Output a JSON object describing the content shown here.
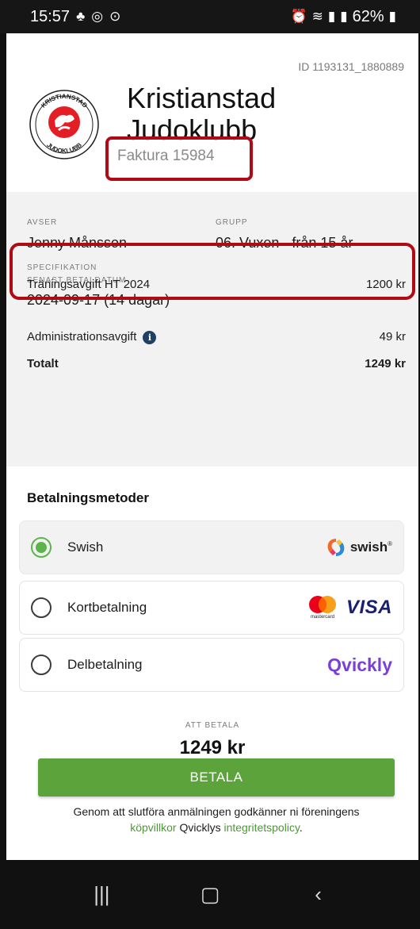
{
  "status_bar": {
    "time": "15:57",
    "battery": "62%",
    "left_icons": [
      "group-icon",
      "nfc-icon",
      "location-icon"
    ],
    "right_icons": [
      "alarm-icon",
      "wifi-icon",
      "signal-icon",
      "signal-icon",
      "battery-icon"
    ]
  },
  "invoice": {
    "id_text": "ID 1193131_1880889",
    "club_name": "Kristianstad Judoklubb",
    "invoice_number": "Faktura 15984",
    "logo": {
      "top_text": "KRISTIANSTAD",
      "bottom_text": "JUDOKLUBB"
    }
  },
  "details": {
    "avser_label": "AVSER",
    "avser_value": "Jenny Månsson",
    "grupp_label": "GRUPP",
    "grupp_value": "06. Vuxen - från 15 år",
    "due_label": "SENAST BETALDATUM",
    "due_value": "2024-09-17 (14 dagar)"
  },
  "specification": {
    "label": "SPECIFIKATION",
    "rows": [
      {
        "name": "Träningsavgift HT 2024",
        "amount": "1200 kr"
      },
      {
        "name": "Administrationsavgift",
        "amount": "49 kr"
      }
    ],
    "total_label": "Totalt",
    "total_amount": "1249 kr"
  },
  "payment_methods": {
    "title": "Betalningsmetoder",
    "selected": "Swish",
    "options": [
      {
        "label": "Swish",
        "logo_text": "swish"
      },
      {
        "label": "Kortbetalning",
        "logo_text": "VISA",
        "sub_logo_text": "mastercard"
      },
      {
        "label": "Delbetalning",
        "logo_text": "Qvickly"
      }
    ]
  },
  "pay": {
    "label": "ATT BETALA",
    "amount": "1249 kr",
    "button": "BETALA",
    "terms_prefix": "Genom att slutföra anmälningen godkänner ni föreningens",
    "terms_link1": "köpvillkor",
    "terms_middle": " Qvicklys ",
    "terms_link2": "integritetspolicy",
    "terms_suffix": "."
  },
  "colors": {
    "accent_green": "#5ca33b",
    "highlight_red": "#b00b14",
    "qvickly_purple": "#7b3fd6",
    "visa_navy": "#1a1f71"
  }
}
